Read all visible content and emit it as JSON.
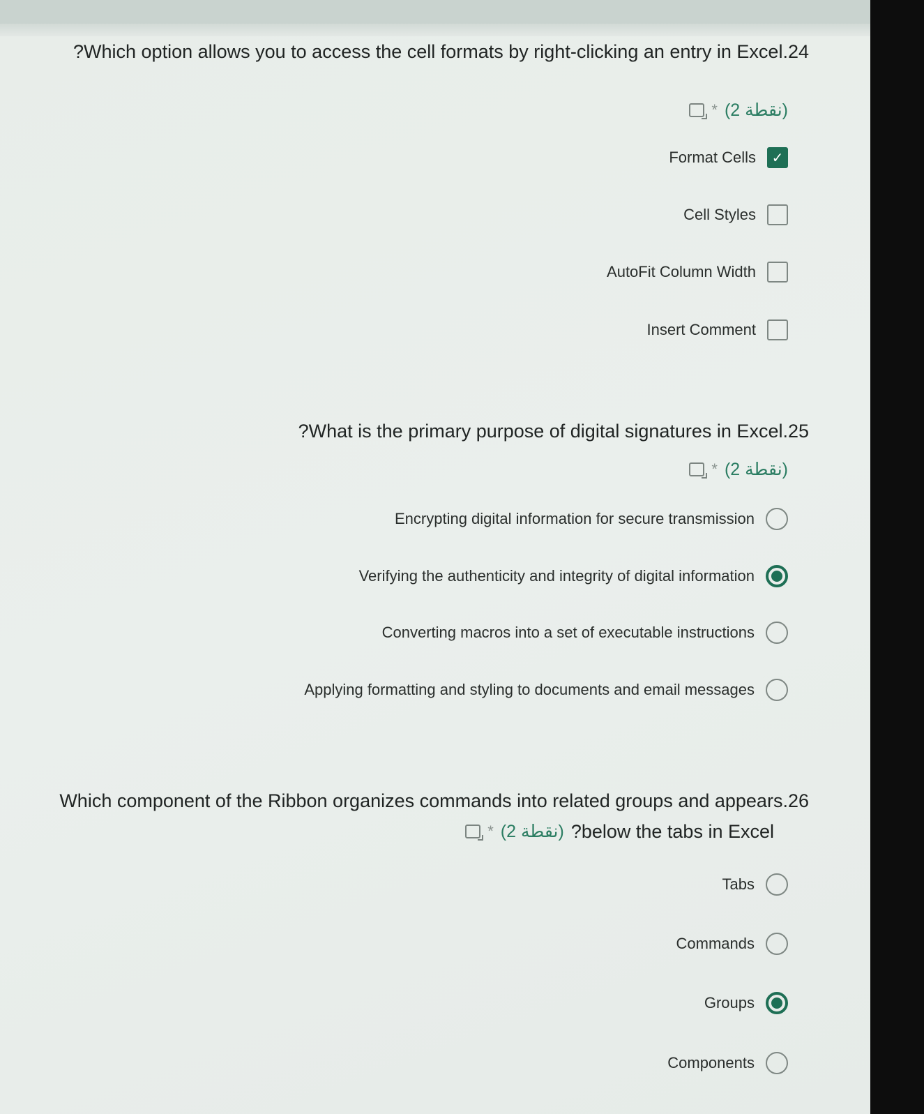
{
  "questions": [
    {
      "number": ".24",
      "text": "?Which option allows you to access the cell formats by right-clicking an entry in Excel",
      "points": "(نقطة 2)",
      "required_mark": "*",
      "speaker_icon": "read-aloud-icon",
      "type": "checkbox",
      "options": [
        {
          "label": "Format Cells",
          "selected": true
        },
        {
          "label": "Cell Styles",
          "selected": false
        },
        {
          "label": "AutoFit Column Width",
          "selected": false
        },
        {
          "label": "Insert Comment",
          "selected": false
        }
      ]
    },
    {
      "number": ".25",
      "text": "?What is the primary purpose of digital signatures in Excel",
      "points": "(نقطة 2)",
      "required_mark": "*",
      "speaker_icon": "read-aloud-icon",
      "type": "radio",
      "options": [
        {
          "label": "Encrypting digital information for secure transmission",
          "selected": false
        },
        {
          "label": "Verifying the authenticity and integrity of digital information",
          "selected": true
        },
        {
          "label": "Converting macros into a set of executable instructions",
          "selected": false
        },
        {
          "label": "Applying formatting and styling to documents and email messages",
          "selected": false
        }
      ]
    },
    {
      "number": ".26",
      "text": "Which component of the Ribbon organizes commands into related groups and appears",
      "text_line2": "?below the tabs in Excel",
      "points": "(نقطة 2)",
      "required_mark": "*",
      "speaker_icon": "read-aloud-icon",
      "type": "radio",
      "options": [
        {
          "label": "Tabs",
          "selected": false
        },
        {
          "label": "Commands",
          "selected": false
        },
        {
          "label": "Groups",
          "selected": true
        },
        {
          "label": "Components",
          "selected": false
        }
      ]
    }
  ],
  "colors": {
    "accent": "#1e6f55",
    "points_text": "#2b7d62",
    "background": "#e7ebe8"
  }
}
